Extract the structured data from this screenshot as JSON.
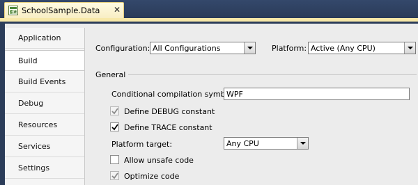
{
  "tab": {
    "title": "SchoolSample.Data",
    "close": "✕"
  },
  "sidebar": {
    "items": [
      {
        "label": "Application"
      },
      {
        "label": "Build"
      },
      {
        "label": "Build Events"
      },
      {
        "label": "Debug"
      },
      {
        "label": "Resources"
      },
      {
        "label": "Services"
      },
      {
        "label": "Settings"
      }
    ],
    "selected": "Build"
  },
  "header": {
    "configuration_label": "Configuration:",
    "configuration_value": "All Configurations",
    "platform_label": "Platform:",
    "platform_value": "Active (Any CPU)"
  },
  "general": {
    "section_title": "General",
    "symbols_label": "Conditional compilation symbols:",
    "symbols_value": "WPF",
    "define_debug_label": "Define DEBUG constant",
    "define_debug_checked": true,
    "define_trace_label": "Define TRACE constant",
    "define_trace_checked": true,
    "platform_target_label": "Platform target:",
    "platform_target_value": "Any CPU",
    "allow_unsafe_label": "Allow unsafe code",
    "allow_unsafe_checked": false,
    "optimize_label": "Optimize code",
    "optimize_checked": true
  },
  "colors": {
    "tab_bg": "#fffbe3",
    "accent": "#f7e8a8",
    "chrome": "#2b3c59",
    "panel": "#ececec"
  }
}
